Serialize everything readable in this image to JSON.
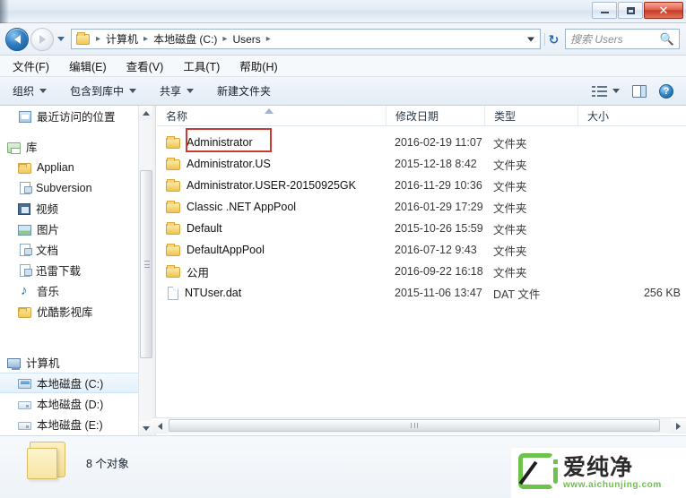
{
  "window": {
    "title": "",
    "buttons": {
      "minimize": "–",
      "maximize": "□",
      "close": "✕"
    }
  },
  "address_bar": {
    "back_label": "后退",
    "forward_label": "前进",
    "history_label": "最近浏览的位置",
    "refresh_label": "↻",
    "breadcrumbs": [
      "计算机",
      "本地磁盘 (C:)",
      "Users"
    ],
    "separator": "▸"
  },
  "search": {
    "placeholder": "搜索 Users",
    "icon": "🔍"
  },
  "menu": {
    "items": [
      {
        "label": "文件(F)"
      },
      {
        "label": "编辑(E)"
      },
      {
        "label": "查看(V)"
      },
      {
        "label": "工具(T)"
      },
      {
        "label": "帮助(H)"
      }
    ]
  },
  "toolbar": {
    "items": [
      {
        "label": "组织",
        "has_caret": true
      },
      {
        "label": "包含到库中",
        "has_caret": true
      },
      {
        "label": "共享",
        "has_caret": true
      },
      {
        "label": "新建文件夹",
        "has_caret": false
      }
    ],
    "right_icons": [
      {
        "name": "view-options-icon"
      },
      {
        "name": "preview-pane-icon"
      },
      {
        "name": "help-icon",
        "glyph": "?"
      }
    ]
  },
  "sidebar": {
    "items": [
      {
        "label": "最近访问的位置",
        "icon": "recent-icon",
        "indent": 1,
        "selected": false
      },
      {
        "label": "库",
        "icon": "library-icon",
        "indent": 0,
        "selected": false
      },
      {
        "label": "Applian",
        "icon": "folder-icon",
        "indent": 1,
        "selected": false
      },
      {
        "label": "Subversion",
        "icon": "document-icon",
        "indent": 1,
        "selected": false
      },
      {
        "label": "视频",
        "icon": "video-icon",
        "indent": 1,
        "selected": false
      },
      {
        "label": "图片",
        "icon": "picture-icon",
        "indent": 1,
        "selected": false
      },
      {
        "label": "文档",
        "icon": "document-icon",
        "indent": 1,
        "selected": false
      },
      {
        "label": "迅雷下载",
        "icon": "document-icon",
        "indent": 1,
        "selected": false
      },
      {
        "label": "音乐",
        "icon": "music-icon",
        "indent": 1,
        "selected": false
      },
      {
        "label": "优酷影视库",
        "icon": "folder-icon",
        "indent": 1,
        "selected": false
      },
      {
        "label": "计算机",
        "icon": "computer-icon",
        "indent": 0,
        "selected": false
      },
      {
        "label": "本地磁盘 (C:)",
        "icon": "system-drive-icon",
        "indent": 1,
        "selected": true
      },
      {
        "label": "本地磁盘 (D:)",
        "icon": "drive-icon",
        "indent": 1,
        "selected": false
      },
      {
        "label": "本地磁盘 (E:)",
        "icon": "drive-icon",
        "indent": 1,
        "selected": false
      }
    ]
  },
  "file_list": {
    "columns": [
      {
        "key": "name",
        "label": "名称",
        "sorted": true
      },
      {
        "key": "date",
        "label": "修改日期",
        "sorted": false
      },
      {
        "key": "type",
        "label": "类型",
        "sorted": false
      },
      {
        "key": "size",
        "label": "大小",
        "sorted": false
      }
    ],
    "rows": [
      {
        "name": "Administrator",
        "date": "2016-02-19 11:07",
        "type": "文件夹",
        "size": "",
        "icon": "folder-icon",
        "highlighted": true
      },
      {
        "name": "Administrator.US",
        "date": "2015-12-18 8:42",
        "type": "文件夹",
        "size": "",
        "icon": "folder-icon",
        "highlighted": false
      },
      {
        "name": "Administrator.USER-20150925GK",
        "date": "2016-11-29 10:36",
        "type": "文件夹",
        "size": "",
        "icon": "folder-icon",
        "highlighted": false
      },
      {
        "name": "Classic .NET AppPool",
        "date": "2016-01-29 17:29",
        "type": "文件夹",
        "size": "",
        "icon": "folder-icon",
        "highlighted": false
      },
      {
        "name": "Default",
        "date": "2015-10-26 15:59",
        "type": "文件夹",
        "size": "",
        "icon": "folder-icon",
        "highlighted": false
      },
      {
        "name": "DefaultAppPool",
        "date": "2016-07-12 9:43",
        "type": "文件夹",
        "size": "",
        "icon": "folder-icon",
        "highlighted": false
      },
      {
        "name": "公用",
        "date": "2016-09-22 16:18",
        "type": "文件夹",
        "size": "",
        "icon": "folder-icon",
        "highlighted": false
      },
      {
        "name": "NTUser.dat",
        "date": "2015-11-06 13:47",
        "type": "DAT 文件",
        "size": "256 KB",
        "icon": "file-icon",
        "highlighted": false
      }
    ],
    "highlight_color": "#cc3b33"
  },
  "status_bar": {
    "text": "8 个对象"
  },
  "watermark": {
    "name": "爱纯净",
    "url": "www.aichunjing.com",
    "color": "#6cc24a"
  }
}
